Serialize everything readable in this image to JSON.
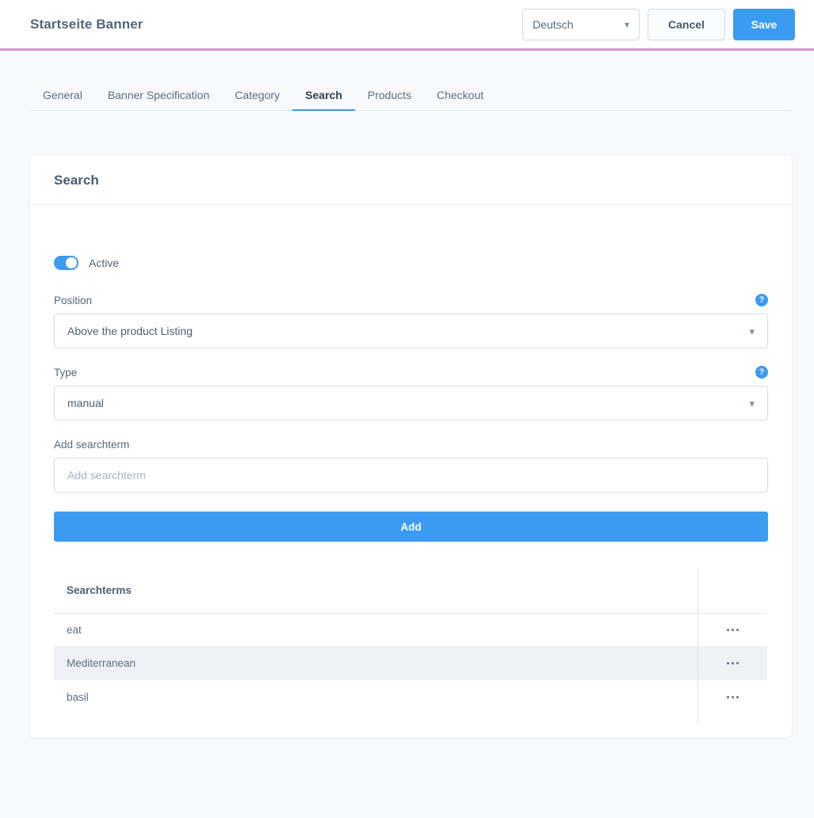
{
  "header": {
    "title": "Startseite Banner",
    "language": {
      "value": "Deutsch",
      "caret": "chevron-down-icon"
    },
    "cancel_label": "Cancel",
    "save_label": "Save",
    "accent_underline_color": "#dd92c9"
  },
  "tabs": [
    {
      "label": "General",
      "active": false
    },
    {
      "label": "Banner Specification",
      "active": false
    },
    {
      "label": "Category",
      "active": false
    },
    {
      "label": "Search",
      "active": true
    },
    {
      "label": "Products",
      "active": false
    },
    {
      "label": "Checkout",
      "active": false
    }
  ],
  "card": {
    "title": "Search",
    "toggle": {
      "label": "Active",
      "state": "on",
      "color": "#3a9bf0"
    },
    "fields": [
      {
        "label": "Position",
        "value": "Above the product Listing",
        "help": "?",
        "type": "select"
      },
      {
        "label": "Type",
        "value": "manual",
        "help": "?",
        "type": "select"
      },
      {
        "label": "Add searchterm",
        "placeholder": "Add searchterm",
        "value": "",
        "type": "input"
      }
    ],
    "add_button_label": "Add",
    "table": {
      "columns": [
        "Searchterms",
        ""
      ],
      "rows": [
        {
          "term": "eat",
          "highlight": false,
          "actions": "more-options"
        },
        {
          "term": "Mediterranean",
          "highlight": true,
          "actions": "more-options"
        },
        {
          "term": "basil",
          "highlight": false,
          "actions": "more-options"
        }
      ]
    }
  },
  "colors": {
    "primary": "#3a9bf0",
    "page_background": "#f8f9fb",
    "row_highlight": "#f0f1f5",
    "text": "#52667a"
  }
}
